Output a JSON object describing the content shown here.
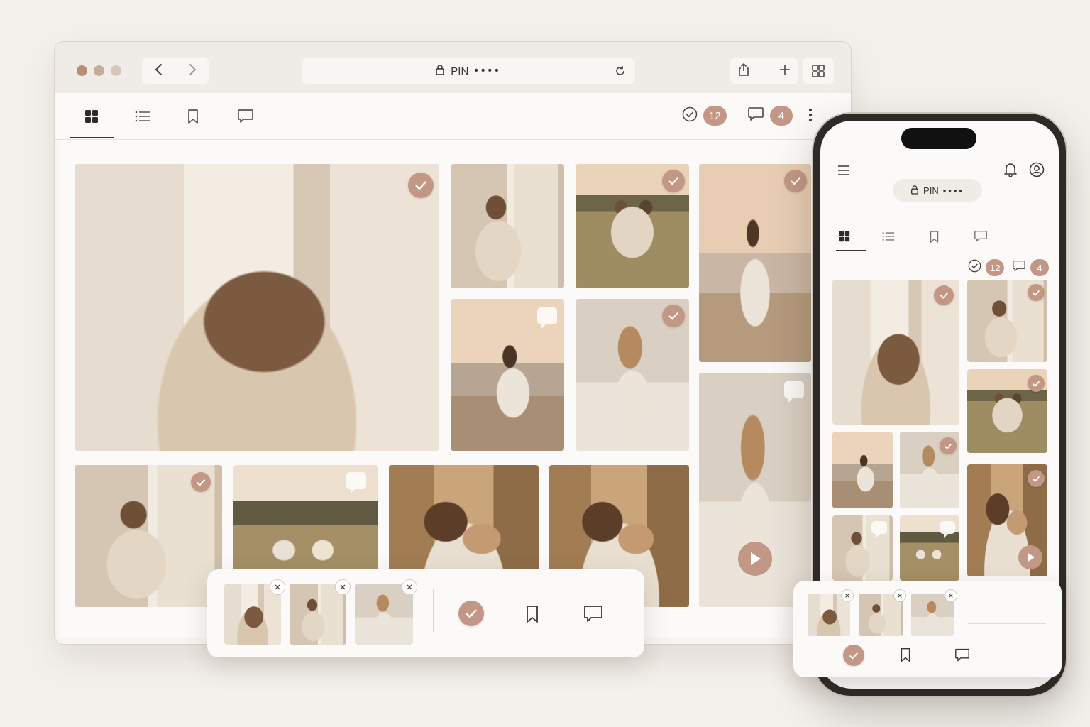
{
  "browser": {
    "address_label": "PIN",
    "address_mask": "••••",
    "selected_count": "12",
    "comments_count": "4"
  },
  "phone": {
    "pin_label": "PIN",
    "pin_mask": "••••",
    "selected_count": "12",
    "comments_count": "4"
  },
  "tabs": [
    "grid",
    "list",
    "bookmarks",
    "comments"
  ],
  "colors": {
    "accent": "#c39785",
    "background": "#f4f1ec",
    "surface": "#fbfaf8"
  },
  "icons": {
    "navigation": [
      "chevron-left-icon",
      "chevron-right-icon"
    ],
    "browser_actions": [
      "share-icon",
      "plus-icon",
      "tab-grid-icon",
      "reload-icon",
      "lock-icon"
    ],
    "photo_badges": [
      "check-icon",
      "comment-icon",
      "play-icon"
    ],
    "tray_actions": [
      "approve-icon",
      "bookmark-icon",
      "comment-icon"
    ],
    "phone_header": [
      "menu-icon",
      "bell-icon",
      "user-icon"
    ]
  }
}
